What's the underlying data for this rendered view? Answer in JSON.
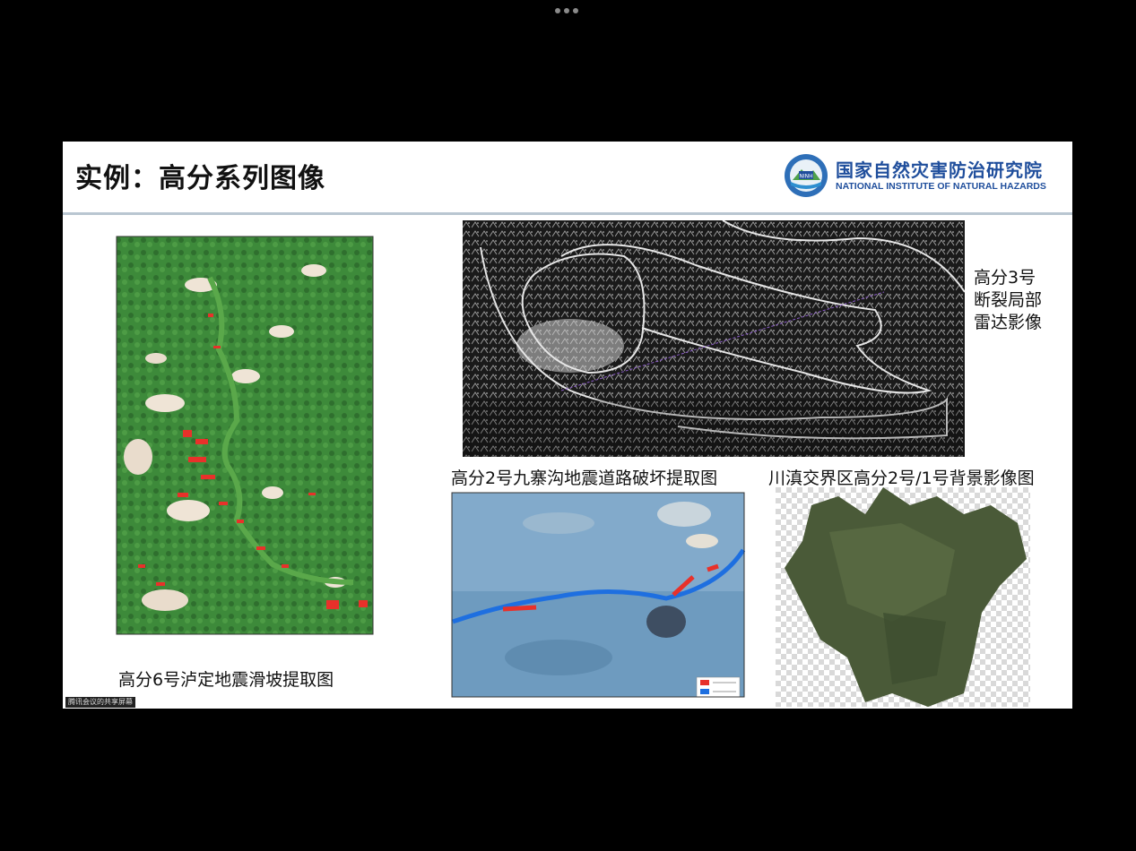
{
  "window": {
    "menu_icon": "more-dots-icon"
  },
  "slide": {
    "title": "实例：高分系列图像",
    "logo": {
      "name_cn": "国家自然灾害防治研究院",
      "name_en": "NATIONAL INSTITUTE OF NATURAL HAZARDS",
      "emblem_text": "NINH"
    },
    "figures": {
      "gf6_caption": "高分6号泸定地震滑坡提取图",
      "gf3_caption_line1": "高分3号",
      "gf3_caption_line2": "断裂局部",
      "gf3_caption_line3": "雷达影像",
      "gf2_road_caption": "高分2号九寨沟地震道路破坏提取图",
      "gf2_bg_caption": "川滇交界区高分2号/1号背景影像图"
    },
    "watermark": "腾讯会议的共享屏幕"
  },
  "colors": {
    "brand_blue": "#1f4e9c",
    "divider": "#b9c6d1",
    "landslide_red": "#e8312a",
    "road_blue": "#1e6fe0"
  }
}
